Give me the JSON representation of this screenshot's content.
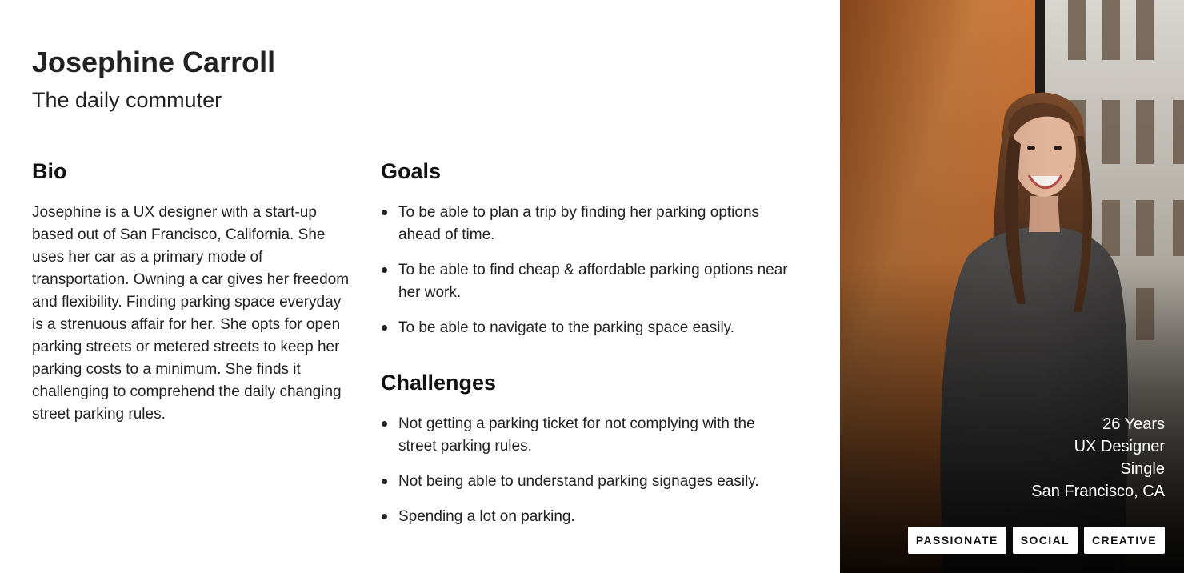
{
  "persona": {
    "name": "Josephine Carroll",
    "subtitle": "The daily commuter"
  },
  "bio": {
    "heading": "Bio",
    "text": "Josephine is a UX designer with a start-up based out of San Francisco, California. She uses her car as a primary mode of transportation. Owning a car gives her freedom and flexibility. Finding parking space everyday is a strenuous affair for her. She opts for open parking streets or metered streets to keep her parking costs to a minimum.  She finds it challenging to comprehend the daily changing street parking rules."
  },
  "goals": {
    "heading": "Goals",
    "items": [
      "To be able to plan a trip by finding her parking options ahead of time.",
      "To be able to find cheap & affordable parking options near her work.",
      "To be able to navigate to the parking space easily."
    ]
  },
  "challenges": {
    "heading": "Challenges",
    "items": [
      "Not getting a parking ticket for not complying with the street parking rules.",
      "Not being able to understand parking signages easily.",
      "Spending a lot on parking."
    ]
  },
  "profile": {
    "age": "26 Years",
    "occupation": "UX Designer",
    "status": "Single",
    "location": "San Francisco, CA",
    "tags": [
      "PASSIONATE",
      "SOCIAL",
      "CREATIVE"
    ]
  },
  "colors": {
    "text": "#222222",
    "photo_orange": "#d9803f",
    "tag_background": "#ffffff"
  }
}
